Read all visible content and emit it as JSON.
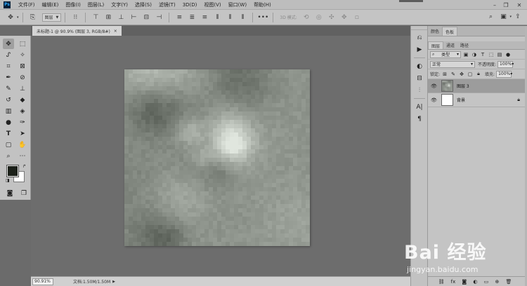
{
  "app": {
    "logo": "Ps",
    "menus": [
      "文件(F)",
      "编辑(E)",
      "图像(I)",
      "图层(L)",
      "文字(Y)",
      "选择(S)",
      "滤镜(T)",
      "3D(D)",
      "视图(V)",
      "窗口(W)",
      "帮助(H)"
    ]
  },
  "options_bar": {
    "layer_select": "图层",
    "mode_3d": "3D 模式:"
  },
  "document": {
    "tab_title": "未标题-1 @ 90.9% (图层 3, RGB/8#)",
    "close": "×"
  },
  "status": {
    "zoom": "90.91%",
    "doc_size": "文档:1.50M/1.50M",
    "arrow": "▶"
  },
  "colors": {
    "foreground": "#1b2019",
    "background": "#ffffff",
    "app_bg": "#6b6b6b"
  },
  "panels": {
    "top_tabs": [
      "颜色",
      "色板"
    ],
    "layer_tabs": [
      "图层",
      "通道",
      "路径"
    ],
    "filter_kind": "类型",
    "blend_mode": "正常",
    "opacity_label": "不透明度:",
    "opacity_value": "100%",
    "lock_label": "锁定:",
    "fill_label": "填充:",
    "fill_value": "100%",
    "layers": [
      {
        "name": "图层 3",
        "selected": true
      },
      {
        "name": "背景",
        "selected": false
      }
    ]
  },
  "watermark": {
    "main": "Bai 经验",
    "sub": "jingyan.baidu.com"
  }
}
